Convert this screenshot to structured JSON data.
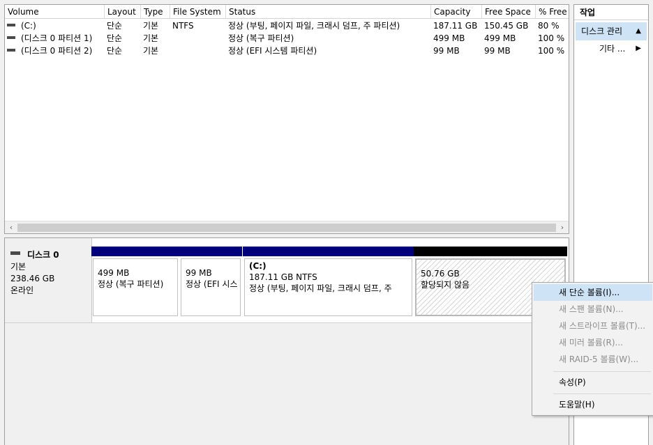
{
  "volume_table": {
    "headers": [
      "Volume",
      "Layout",
      "Type",
      "File System",
      "Status",
      "Capacity",
      "Free Space",
      "% Free"
    ],
    "rows": [
      [
        "(C:)",
        "단순",
        "기본",
        "NTFS",
        "정상 (부팅, 페이지 파일, 크래시 덤프, 주 파티션)",
        "187.11 GB",
        "150.45 GB",
        "80 %"
      ],
      [
        "(디스크 0 파티션 1)",
        "단순",
        "기본",
        "",
        "정상 (복구 파티션)",
        "499 MB",
        "499 MB",
        "100 %"
      ],
      [
        "(디스크 0 파티션 2)",
        "단순",
        "기본",
        "",
        "정상 (EFI 시스템 파티션)",
        "99 MB",
        "99 MB",
        "100 %"
      ]
    ],
    "scroll_left": "‹",
    "scroll_right": "›"
  },
  "disk": {
    "name": "디스크 0",
    "type": "기본",
    "size": "238.46 GB",
    "state": "온라인",
    "partitions": [
      {
        "title": "",
        "size": "499 MB",
        "status": "정상 (복구 파티션)",
        "bar_color": "#00007c"
      },
      {
        "title": "",
        "size": "99 MB",
        "status": "정상 (EFI 시스",
        "bar_color": "#00007c"
      },
      {
        "title": "(C:)",
        "size": "187.11 GB NTFS",
        "status": "정상 (부팅, 페이지 파일, 크래시 덤프, 주",
        "bar_color": "#00007c"
      },
      {
        "title": "",
        "size": "50.76 GB",
        "status": "할당되지 않음",
        "bar_color": "#000000"
      }
    ]
  },
  "actions": {
    "title": "작업",
    "section": "디스크 관리",
    "section_arrow": "▲",
    "item": "기타 ...",
    "item_arrow": "▶"
  },
  "context_menu": {
    "items": [
      {
        "label": "새 단순 볼륨(I)...",
        "enabled": true,
        "highlighted": true
      },
      {
        "label": "새 스팬 볼륨(N)...",
        "enabled": false
      },
      {
        "label": "새 스트라이프 볼륨(T)...",
        "enabled": false
      },
      {
        "label": "새 미러 볼륨(R)...",
        "enabled": false
      },
      {
        "label": "새 RAID-5 볼륨(W)...",
        "enabled": false
      },
      {
        "label": "속성(P)",
        "enabled": true
      },
      {
        "label": "도움말(H)",
        "enabled": true
      }
    ]
  },
  "colors": {
    "primary_partition_bar": "#00007c",
    "unallocated_bar": "#000000",
    "selection_highlight": "#cfe3f7"
  }
}
